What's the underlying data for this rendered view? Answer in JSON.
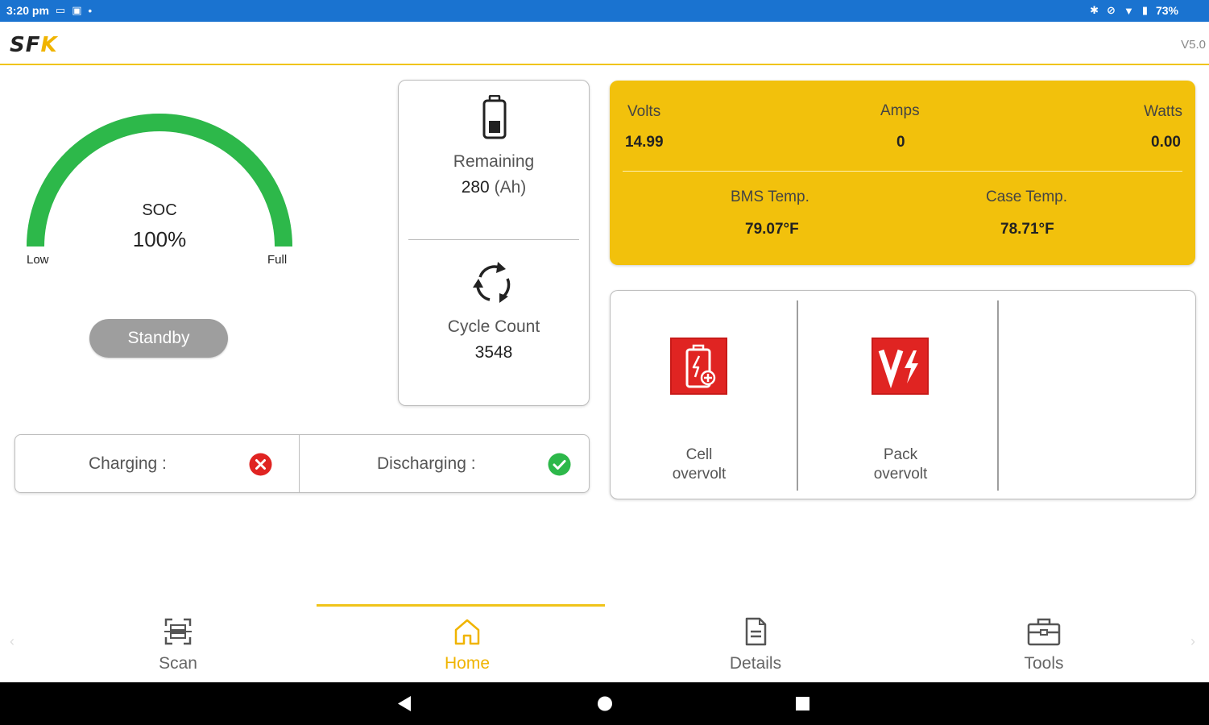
{
  "status_bar": {
    "time": "3:20 pm",
    "battery": "73%"
  },
  "header": {
    "logo_main": "SF",
    "logo_accent": "K",
    "version": "V5.0"
  },
  "gauge": {
    "title": "SOC",
    "value": "100%",
    "fill_percent": 100,
    "low_label": "Low",
    "full_label": "Full",
    "color": "#2db84a"
  },
  "standby_button": "Standby",
  "remaining": {
    "label": "Remaining",
    "value": "280",
    "unit": "(Ah)"
  },
  "cycle": {
    "label": "Cycle Count",
    "value": "3548"
  },
  "charge_status": {
    "charging_label": "Charging :",
    "charging_state": "error-x-icon",
    "discharging_label": "Discharging :",
    "discharging_state": "ok-check-icon"
  },
  "metrics": {
    "volts_label": "Volts",
    "volts_value": "14.99",
    "amps_label": "Amps",
    "amps_value": "0",
    "watts_label": "Watts",
    "watts_value": "0.00",
    "bms_temp_label": "BMS Temp.",
    "bms_temp_value": "79.07°F",
    "case_temp_label": "Case Temp.",
    "case_temp_value": "78.71°F",
    "background": "#f2c10c"
  },
  "alerts": [
    {
      "line1": "Cell",
      "line2": "overvolt",
      "icon": "cell-overvolt-icon"
    },
    {
      "line1": "Pack",
      "line2": "overvolt",
      "icon": "pack-overvolt-icon"
    }
  ],
  "nav": {
    "scan": "Scan",
    "home": "Home",
    "details": "Details",
    "tools": "Tools",
    "active": "home",
    "accent": "#f0c419"
  },
  "colors": {
    "status_bar": "#1a73d0",
    "alert_red": "#e02422",
    "ok_green": "#2db84a"
  }
}
